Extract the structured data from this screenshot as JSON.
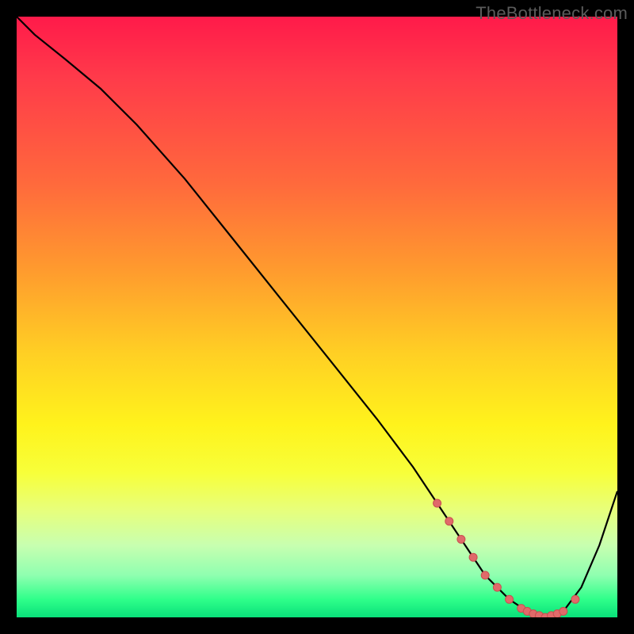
{
  "watermark": "TheBottleneck.com",
  "colors": {
    "curve": "#000000",
    "marker": "#e06a6a",
    "marker_stroke": "#c94f4f"
  },
  "chart_data": {
    "type": "line",
    "title": "",
    "xlabel": "",
    "ylabel": "",
    "xlim": [
      0,
      100
    ],
    "ylim": [
      0,
      100
    ],
    "grid": false,
    "legend": false,
    "series": [
      {
        "name": "bottleneck-curve",
        "x": [
          0,
          3,
          8,
          14,
          20,
          28,
          36,
          44,
          52,
          60,
          66,
          70,
          74,
          78,
          82,
          85,
          88,
          91,
          94,
          97,
          100
        ],
        "y": [
          100,
          97,
          93,
          88,
          82,
          73,
          63,
          53,
          43,
          33,
          25,
          19,
          13,
          7,
          3,
          1,
          0,
          1,
          5,
          12,
          21
        ]
      }
    ],
    "markers": {
      "series": "bottleneck-curve",
      "x": [
        70,
        72,
        74,
        76,
        78,
        80,
        82,
        84,
        85,
        86,
        87,
        88,
        89,
        90,
        91,
        93
      ],
      "y": [
        19,
        16,
        13,
        10,
        7,
        5,
        3,
        1.5,
        1,
        0.6,
        0.3,
        0,
        0.3,
        0.6,
        1,
        3
      ],
      "r": 5
    }
  }
}
